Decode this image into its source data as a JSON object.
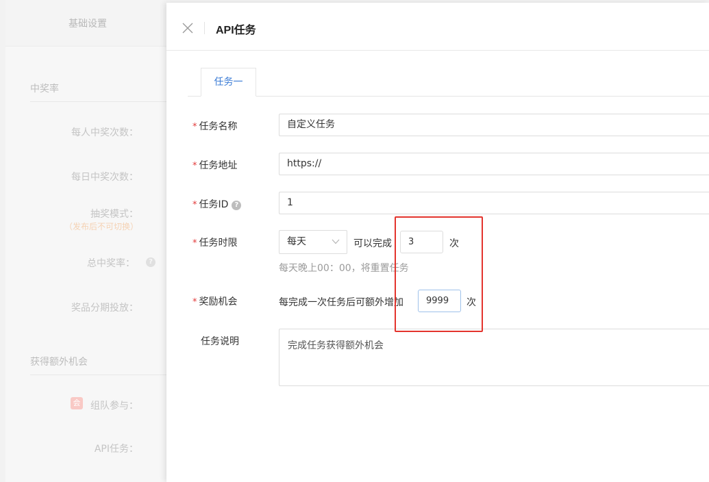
{
  "background": {
    "tab_label": "基础设置",
    "sections": {
      "win_rate": "中奖率",
      "extra_chances": "获得额外机会"
    },
    "fields": {
      "per_person_wins": "每人中奖次数：",
      "daily_wins": "每日中奖次数：",
      "draw_mode": "抽奖模式：",
      "draw_mode_note": "（发布后不可切换）",
      "total_win_rate": "总中奖率：",
      "prize_schedule": "奖品分期投放：",
      "team_join": "组队参与：",
      "api_task": "API任务："
    },
    "badge_glyph": "会",
    "help_glyph": "?"
  },
  "drawer": {
    "title": "API任务",
    "close_icon": "close-icon",
    "tabs": [
      {
        "label": "任务一",
        "active": true
      }
    ],
    "form": {
      "required_mark": "*",
      "task_name": {
        "label": "任务名称",
        "value": "自定义任务"
      },
      "task_url": {
        "label": "任务地址",
        "value": "https://"
      },
      "task_id": {
        "label": "任务ID",
        "value": "1",
        "help_glyph": "?"
      },
      "task_limit": {
        "label": "任务时限",
        "period": "每天",
        "can_complete_text": "可以完成",
        "count": "3",
        "unit": "次",
        "hint": "每天晚上00：00，将重置任务"
      },
      "reward": {
        "label": "奖励机会",
        "text": "每完成一次任务后可额外增加",
        "count": "9999",
        "unit": "次"
      },
      "description": {
        "label": "任务说明",
        "value": "完成任务获得额外机会"
      }
    }
  },
  "colors": {
    "accent": "#3a7bd5",
    "required": "#e23a3a",
    "annotation": "#e3332c"
  }
}
